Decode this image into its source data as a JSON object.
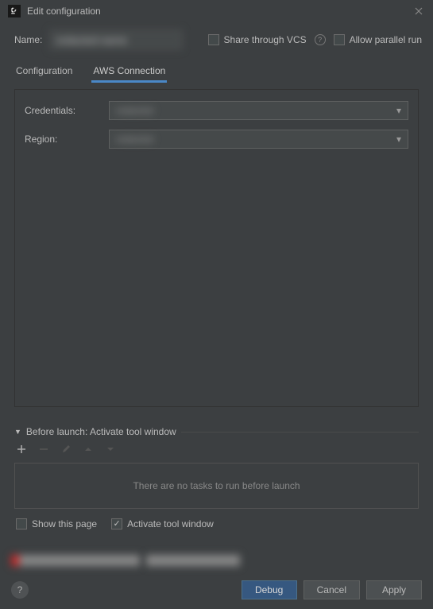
{
  "titlebar": {
    "title": "Edit configuration"
  },
  "form": {
    "name_label": "Name:",
    "name_value": "redacted-name",
    "share_vcs_label": "Share through VCS",
    "allow_parallel_label": "Allow parallel run"
  },
  "tabs": {
    "configuration": "Configuration",
    "aws": "AWS Connection",
    "active": "aws"
  },
  "aws_panel": {
    "credentials_label": "Credentials:",
    "credentials_value": "redacted",
    "region_label": "Region:",
    "region_value": "redacted"
  },
  "before_launch": {
    "header": "Before launch: Activate tool window",
    "empty_text": "There are no tasks to run before launch",
    "show_page_label": "Show this page",
    "activate_tool_label": "Activate tool window",
    "show_page_checked": false,
    "activate_tool_checked": true
  },
  "buttons": {
    "debug": "Debug",
    "cancel": "Cancel",
    "apply": "Apply"
  }
}
